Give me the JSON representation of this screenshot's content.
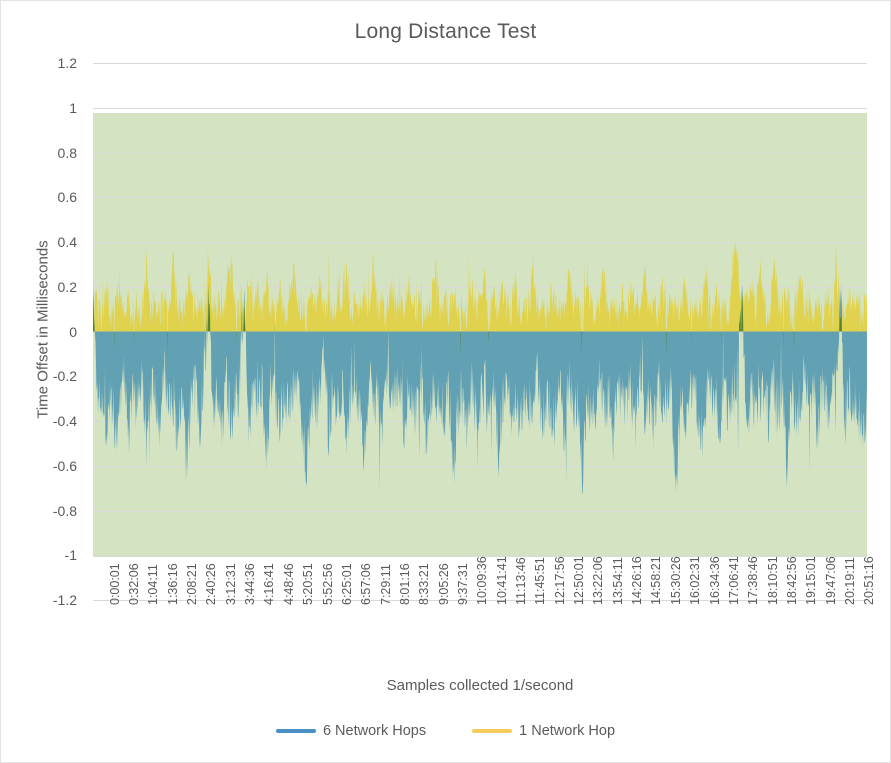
{
  "chart_data": {
    "type": "area",
    "title": "Long Distance Test",
    "xlabel": "Samples collected 1/second",
    "ylabel": "Time Offset in Milliseconds",
    "ylim": [
      -1.2,
      1.2
    ],
    "ytick_step": 0.2,
    "grid": true,
    "legend_position": "bottom",
    "plot_band": [
      -1,
      1
    ],
    "plot_background": "#d4e4c2",
    "yticks": [
      "1.2",
      "1",
      "0.8",
      "0.6",
      "0.4",
      "0.2",
      "0",
      "-0.2",
      "-0.4",
      "-0.6",
      "-0.8",
      "-1",
      "-1.2"
    ],
    "ytick_values": [
      1.2,
      1,
      0.8,
      0.6,
      0.4,
      0.2,
      0,
      -0.2,
      -0.4,
      -0.6,
      -0.8,
      -1,
      -1.2
    ],
    "categories": [
      "0:00:01",
      "0:32:06",
      "1:04:11",
      "1:36:16",
      "2:08:21",
      "2:40:26",
      "3:12:31",
      "3:44:36",
      "4:16:41",
      "4:48:46",
      "5:20:51",
      "5:52:56",
      "6:25:01",
      "6:57:06",
      "7:29:11",
      "8:01:16",
      "8:33:21",
      "9:05:26",
      "9:37:31",
      "10:09:36",
      "10:41:41",
      "11:13:46",
      "11:45:51",
      "12:17:56",
      "12:50:01",
      "13:22:06",
      "13:54:11",
      "14:26:16",
      "14:58:21",
      "15:30:26",
      "16:02:31",
      "16:34:36",
      "17:06:41",
      "17:38:46",
      "18:10:51",
      "18:42:56",
      "19:15:01",
      "19:47:06",
      "20:19:11",
      "20:51:16"
    ],
    "series": [
      {
        "name": "6 Network Hops",
        "color": "#4a90c4",
        "fill_color": "#62a0b4",
        "baseline_mean": -0.3,
        "min": -0.73,
        "max": 0.22,
        "values": [
          0.17,
          -0.31,
          -0.26,
          -0.44,
          -0.29,
          -0.52,
          -0.33,
          -0.21,
          -0.47,
          -0.28,
          -0.38,
          -0.22,
          -0.55,
          -0.31,
          -0.27,
          -0.43,
          -0.19,
          -0.36,
          -0.3,
          -0.48,
          -0.24,
          -0.61,
          -0.33,
          -0.27,
          -0.42,
          -0.18,
          0.12,
          -0.35,
          -0.29,
          -0.51,
          -0.23,
          -0.4,
          -0.32,
          -0.26,
          0.21,
          -0.44,
          -0.3,
          -0.37,
          -0.22,
          -0.56,
          -0.28,
          -0.33,
          -0.47,
          -0.25,
          -0.39,
          -0.3,
          -0.2,
          -0.43,
          -0.7,
          -0.27,
          -0.35,
          -0.31,
          -0.1,
          -0.49,
          -0.24,
          -0.38,
          -0.29,
          -0.45,
          -0.33,
          -0.21,
          -0.4,
          -0.58,
          -0.26,
          -0.34,
          -0.3,
          -0.47,
          -0.22,
          -0.36,
          -0.31,
          -0.25,
          -0.43,
          -0.28,
          -0.39,
          -0.32,
          -0.19,
          -0.5,
          -0.27,
          -0.35,
          -0.3,
          -0.41,
          -0.24,
          -0.66,
          -0.33,
          -0.28,
          -0.46,
          -0.21,
          -0.37,
          -0.31,
          -0.26,
          -0.44,
          -0.29,
          -0.52,
          -0.34,
          -0.23,
          -0.38,
          -0.3,
          -0.42,
          -0.27,
          -0.35,
          -0.31,
          -0.17,
          -0.48,
          -0.25,
          -0.4,
          -0.32,
          -0.28,
          -0.45,
          -0.22,
          -0.36,
          -0.3,
          -0.71,
          -0.26,
          -0.43,
          -0.33,
          -0.19,
          -0.39,
          -0.29,
          -0.51,
          -0.24,
          -0.37,
          -0.31,
          -0.27,
          -0.44,
          -0.21,
          -0.35,
          -0.3,
          -0.47,
          -0.23,
          -0.38,
          -0.32,
          -0.26,
          -0.73,
          -0.28,
          -0.41,
          -0.3,
          -0.2,
          -0.36,
          -0.49,
          -0.25,
          -0.34,
          -0.31,
          -0.43,
          -0.27,
          -0.39,
          -0.29,
          -0.18,
          0.15,
          -0.46,
          -0.24,
          -0.37,
          -0.32,
          -0.28,
          -0.42,
          -0.22,
          -0.35,
          -0.3,
          -0.64,
          -0.26,
          -0.4,
          -0.33,
          -0.21,
          -0.38,
          -0.29,
          -0.47,
          -0.25,
          -0.36,
          -0.31,
          -0.27,
          0.16,
          -0.44,
          -0.23,
          -0.39,
          -0.3,
          -0.48,
          -0.34
        ]
      },
      {
        "name": "1 Network Hop",
        "color": "#f5cd5b",
        "fill_color": "#e0d24d",
        "baseline_mean": 0.05,
        "min": -0.12,
        "max": 0.41,
        "values": [
          0.08,
          0.14,
          0.05,
          0.19,
          0.07,
          0.11,
          0.22,
          0.06,
          0.16,
          0.09,
          0.13,
          0.04,
          0.26,
          0.08,
          0.12,
          0.07,
          0.18,
          0.05,
          0.32,
          0.1,
          0.06,
          0.15,
          0.21,
          0.08,
          0.11,
          0.04,
          0.27,
          0.09,
          0.14,
          0.06,
          0.17,
          0.34,
          0.07,
          0.12,
          0.05,
          0.2,
          0.09,
          0.15,
          0.06,
          0.24,
          0.1,
          0.07,
          0.18,
          0.05,
          0.13,
          0.28,
          0.08,
          0.11,
          0.06,
          0.16,
          0.09,
          0.22,
          0.07,
          0.14,
          0.05,
          0.19,
          0.1,
          0.25,
          0.08,
          0.12,
          0.06,
          0.17,
          0.09,
          0.3,
          0.07,
          0.13,
          0.05,
          0.21,
          0.08,
          0.15,
          0.06,
          0.23,
          0.1,
          0.09,
          0.18,
          0.04,
          0.12,
          0.27,
          0.07,
          0.14,
          0.06,
          0.16,
          0.09,
          0.11,
          0.05,
          0.2,
          0.08,
          0.13,
          0.24,
          0.07,
          0.15,
          0.06,
          0.18,
          0.1,
          0.09,
          0.22,
          0.05,
          0.12,
          0.07,
          0.26,
          0.08,
          0.14,
          0.06,
          0.17,
          0.09,
          0.11,
          0.04,
          0.29,
          0.08,
          0.13,
          0.06,
          0.19,
          0.1,
          0.07,
          0.15,
          0.23,
          0.05,
          0.12,
          0.08,
          0.16,
          0.06,
          0.2,
          0.09,
          0.11,
          0.28,
          0.07,
          0.14,
          0.05,
          0.18,
          0.08,
          0.1,
          0.13,
          0.06,
          0.21,
          0.09,
          0.16,
          0.07,
          0.12,
          0.25,
          0.05,
          0.17,
          0.08,
          0.11,
          0.06,
          0.41,
          0.3,
          0.09,
          0.14,
          0.22,
          0.07,
          0.34,
          0.1,
          0.05,
          0.33,
          0.13,
          0.08,
          0.18,
          0.06,
          0.11,
          0.24,
          0.09,
          0.15,
          0.07,
          0.12,
          0.05,
          0.19,
          0.08,
          0.26,
          0.1,
          0.06,
          0.14,
          0.09,
          0.17,
          0.07,
          0.11
        ]
      }
    ]
  },
  "legend": {
    "items": [
      {
        "label": "6 Network Hops",
        "color": "#4a90c4"
      },
      {
        "label": "1 Network Hop",
        "color": "#f5cd5b"
      }
    ]
  }
}
